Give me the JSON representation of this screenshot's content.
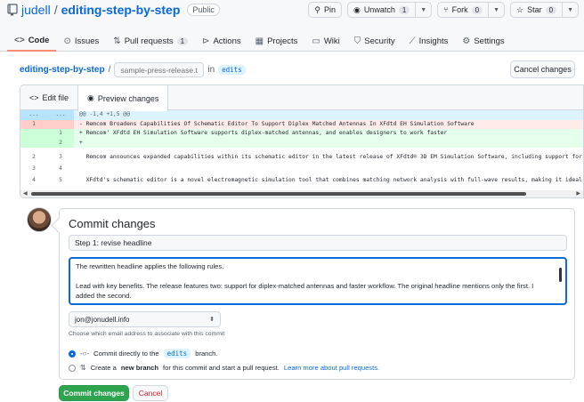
{
  "repo": {
    "owner": "judell",
    "separator": "/",
    "name": "editing-step-by-step",
    "visibility": "Public"
  },
  "actions": {
    "pin": "Pin",
    "unwatch": "Unwatch",
    "unwatch_count": "1",
    "fork": "Fork",
    "fork_count": "0",
    "star": "Star",
    "star_count": "0"
  },
  "tabs": [
    {
      "label": "Code",
      "icon": "code-icon"
    },
    {
      "label": "Issues",
      "icon": "issue-icon"
    },
    {
      "label": "Pull requests",
      "icon": "pr-icon",
      "count": "1"
    },
    {
      "label": "Actions",
      "icon": "play-icon"
    },
    {
      "label": "Projects",
      "icon": "table-icon"
    },
    {
      "label": "Wiki",
      "icon": "book-icon"
    },
    {
      "label": "Security",
      "icon": "shield-icon"
    },
    {
      "label": "Insights",
      "icon": "graph-icon"
    },
    {
      "label": "Settings",
      "icon": "gear-icon"
    }
  ],
  "breadcrumb": {
    "root": "editing-step-by-step",
    "slash": "/",
    "filename_placeholder": "sample-press-release.txt",
    "in": "in",
    "branch": "edits",
    "cancel": "Cancel changes"
  },
  "editor": {
    "tab_edit": "Edit file",
    "tab_preview": "Preview changes",
    "hunk": "@@ -1,4 +1,5 @@",
    "hunk_ln": "...",
    "lines": [
      {
        "type": "del",
        "old": "1",
        "new": "",
        "text": "- Remcom Broadens Capabilities Of Schematic Editor To Support Diplex Matched Antennas In XFdtd EH Simulation Software"
      },
      {
        "type": "add",
        "old": "",
        "new": "1",
        "text": "+ Remcom' XFdtd EH Simulation Software supports diplex-matched antennas, and enables designers to work faster"
      },
      {
        "type": "add",
        "old": "",
        "new": "2",
        "text": "+"
      },
      {
        "type": "ctx",
        "old": "2",
        "new": "3",
        "text": "  Remcom announces expanded capabilities within its schematic editor in the latest release of XFdtd® 3D EM Simulation Software, including support for dip"
      },
      {
        "type": "ctx",
        "old": "3",
        "new": "4",
        "text": ""
      },
      {
        "type": "ctx",
        "old": "4",
        "new": "5",
        "text": "  XFdtd's schematic editor is a novel electromagnetic simulation tool that combines matching network analysis with full-wave results, making it ideal for"
      }
    ]
  },
  "commit": {
    "heading": "Commit changes",
    "summary_value": "Step 1: revise headline",
    "description_p1": "The rewritten headline applies the following rules.",
    "description_p2": "Lead with key benefits. The release features two: support for diplex-matched antennas and faster workflow. The original headline mentions only the first. I added the second.",
    "email": "jon@jonudell.info",
    "email_hint": "Choose which email address to associate with this commit",
    "option_direct_pre": "Commit directly to the",
    "option_direct_branch": "edits",
    "option_direct_post": "branch.",
    "option_new_pre": "Create a",
    "option_new_bold": "new branch",
    "option_new_post": "for this commit and start a pull request.",
    "option_new_link": "Learn more about pull requests.",
    "submit": "Commit changes",
    "cancel": "Cancel"
  },
  "colors": {
    "primary_button": "#2da44e",
    "link": "#0969da",
    "active_tab_underline": "#fd8c73",
    "diff_add": "#e6ffec",
    "diff_del": "#ffebe9"
  }
}
